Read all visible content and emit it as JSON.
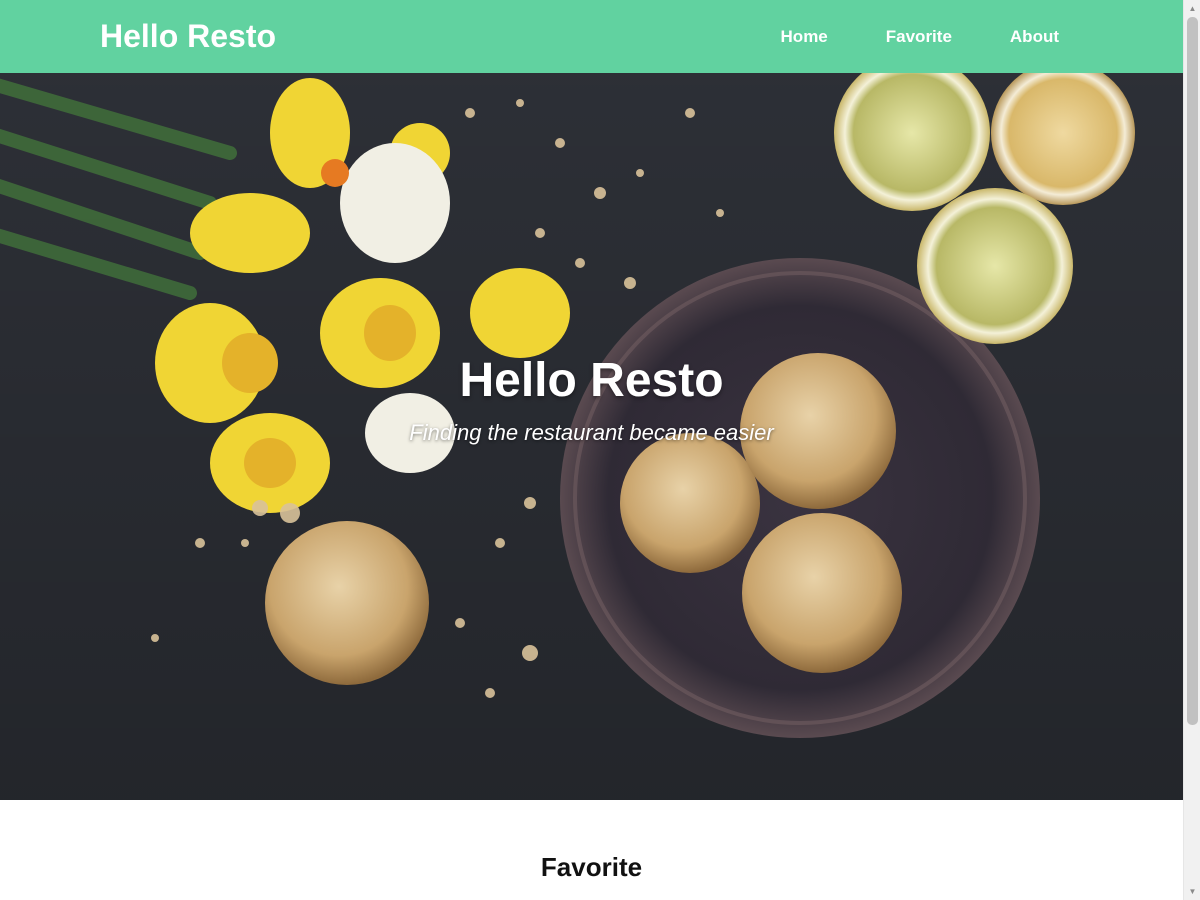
{
  "header": {
    "brand": "Hello Resto",
    "nav": [
      "Home",
      "Favorite",
      "About"
    ]
  },
  "hero": {
    "title": "Hello Resto",
    "subtitle": "Finding the restaurant became easier"
  },
  "content": {
    "section_title": "Favorite"
  },
  "colors": {
    "header_bg": "#61d2a0",
    "hero_bg": "#2e3138"
  },
  "icons": {
    "scroll_up": "chevron-up-icon",
    "scroll_down": "chevron-down-icon"
  }
}
